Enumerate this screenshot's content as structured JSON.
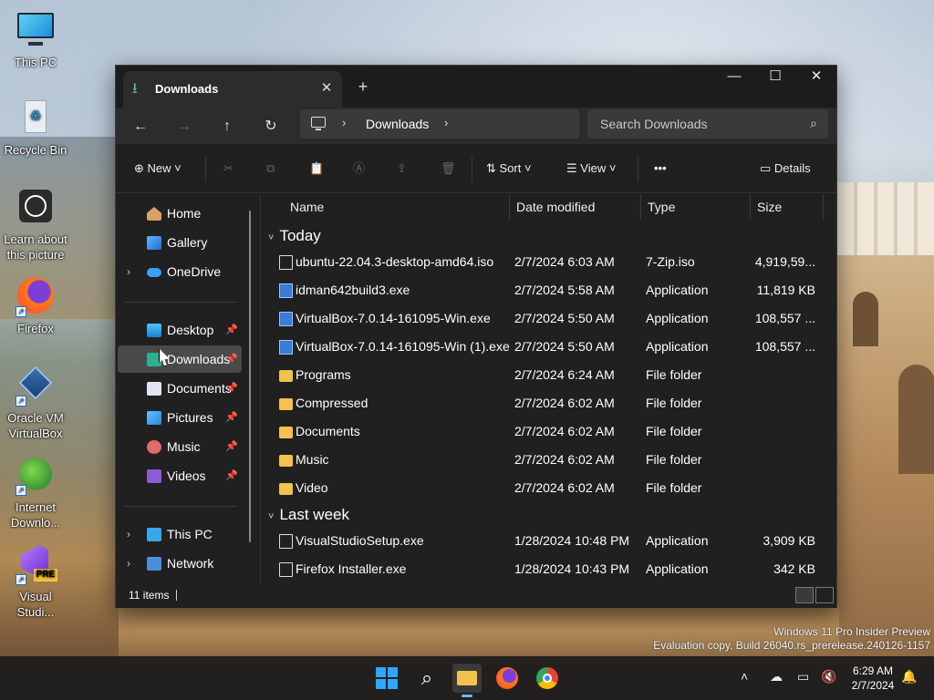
{
  "desktop": {
    "icons": [
      {
        "label": "This PC"
      },
      {
        "label": "Recycle Bin"
      },
      {
        "label": "Learn about this picture"
      },
      {
        "label": "Firefox"
      },
      {
        "label": "Oracle VM VirtualBox"
      },
      {
        "label": "Internet Downlo..."
      },
      {
        "label": "Visual Studi..."
      }
    ],
    "watermark_line1": "Windows 11 Pro Insider Preview",
    "watermark_line2": "Evaluation copy. Build 26040.rs_prerelease.240126-1157"
  },
  "window": {
    "tab_title": "Downloads",
    "breadcrumb": "Downloads",
    "search_placeholder": "Search Downloads",
    "toolbar": {
      "new_label": "New",
      "sort_label": "Sort",
      "view_label": "View",
      "more_label": "•••",
      "details_label": "Details"
    },
    "nav": {
      "home": "Home",
      "gallery": "Gallery",
      "onedrive": "OneDrive",
      "desktop": "Desktop",
      "downloads": "Downloads",
      "documents": "Documents",
      "pictures": "Pictures",
      "music": "Music",
      "videos": "Videos",
      "this_pc": "This PC",
      "network": "Network"
    },
    "columns": {
      "name": "Name",
      "date": "Date modified",
      "type": "Type",
      "size": "Size"
    },
    "groups": [
      {
        "label": "Today",
        "rows": [
          {
            "name": "ubuntu-22.04.3-desktop-amd64.iso",
            "date": "2/7/2024 6:03 AM",
            "type": "7-Zip.iso",
            "size": "4,919,59...",
            "icon": "document-icon"
          },
          {
            "name": "idman642build3.exe",
            "date": "2/7/2024 5:58 AM",
            "type": "Application",
            "size": "11,819 KB",
            "icon": "application-icon"
          },
          {
            "name": "VirtualBox-7.0.14-161095-Win.exe",
            "date": "2/7/2024 5:50 AM",
            "type": "Application",
            "size": "108,557 ...",
            "icon": "application-icon"
          },
          {
            "name": "VirtualBox-7.0.14-161095-Win (1).exe",
            "date": "2/7/2024 5:50 AM",
            "type": "Application",
            "size": "108,557 ...",
            "icon": "application-icon"
          },
          {
            "name": "Programs",
            "date": "2/7/2024 6:24 AM",
            "type": "File folder",
            "size": "",
            "icon": "folder-icon"
          },
          {
            "name": "Compressed",
            "date": "2/7/2024 6:02 AM",
            "type": "File folder",
            "size": "",
            "icon": "folder-icon"
          },
          {
            "name": "Documents",
            "date": "2/7/2024 6:02 AM",
            "type": "File folder",
            "size": "",
            "icon": "folder-icon"
          },
          {
            "name": "Music",
            "date": "2/7/2024 6:02 AM",
            "type": "File folder",
            "size": "",
            "icon": "folder-icon"
          },
          {
            "name": "Video",
            "date": "2/7/2024 6:02 AM",
            "type": "File folder",
            "size": "",
            "icon": "folder-icon"
          }
        ]
      },
      {
        "label": "Last week",
        "rows": [
          {
            "name": "VisualStudioSetup.exe",
            "date": "1/28/2024 10:48 PM",
            "type": "Application",
            "size": "3,909 KB",
            "icon": "document-icon"
          },
          {
            "name": "Firefox Installer.exe",
            "date": "1/28/2024 10:43 PM",
            "type": "Application",
            "size": "342 KB",
            "icon": "document-icon"
          }
        ]
      }
    ],
    "status": "11 items"
  },
  "taskbar": {
    "time": "6:29 AM",
    "date": "2/7/2024"
  },
  "colors": {
    "window_bg": "#202020",
    "selection": "#4a4a4a",
    "folder": "#f2c14e",
    "accent": "#0078d4"
  }
}
